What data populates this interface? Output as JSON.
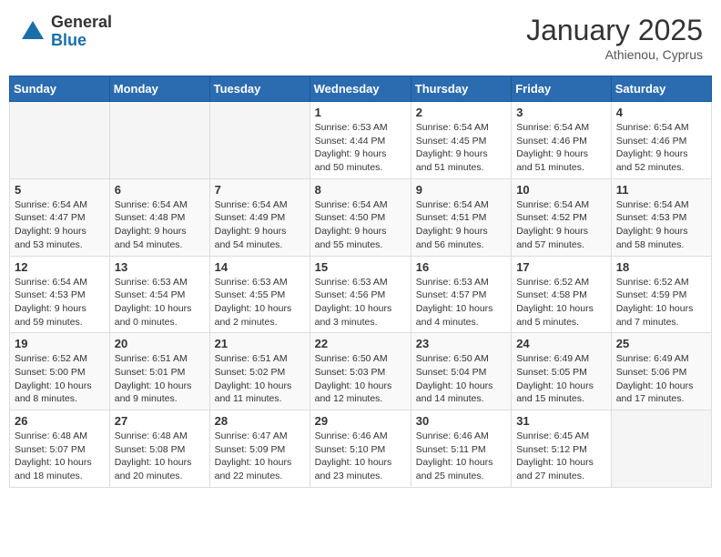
{
  "header": {
    "logo_general": "General",
    "logo_blue": "Blue",
    "month_title": "January 2025",
    "location": "Athienou, Cyprus"
  },
  "days_of_week": [
    "Sunday",
    "Monday",
    "Tuesday",
    "Wednesday",
    "Thursday",
    "Friday",
    "Saturday"
  ],
  "weeks": [
    [
      {
        "day": "",
        "info": ""
      },
      {
        "day": "",
        "info": ""
      },
      {
        "day": "",
        "info": ""
      },
      {
        "day": "1",
        "info": "Sunrise: 6:53 AM\nSunset: 4:44 PM\nDaylight: 9 hours\nand 50 minutes."
      },
      {
        "day": "2",
        "info": "Sunrise: 6:54 AM\nSunset: 4:45 PM\nDaylight: 9 hours\nand 51 minutes."
      },
      {
        "day": "3",
        "info": "Sunrise: 6:54 AM\nSunset: 4:46 PM\nDaylight: 9 hours\nand 51 minutes."
      },
      {
        "day": "4",
        "info": "Sunrise: 6:54 AM\nSunset: 4:46 PM\nDaylight: 9 hours\nand 52 minutes."
      }
    ],
    [
      {
        "day": "5",
        "info": "Sunrise: 6:54 AM\nSunset: 4:47 PM\nDaylight: 9 hours\nand 53 minutes."
      },
      {
        "day": "6",
        "info": "Sunrise: 6:54 AM\nSunset: 4:48 PM\nDaylight: 9 hours\nand 54 minutes."
      },
      {
        "day": "7",
        "info": "Sunrise: 6:54 AM\nSunset: 4:49 PM\nDaylight: 9 hours\nand 54 minutes."
      },
      {
        "day": "8",
        "info": "Sunrise: 6:54 AM\nSunset: 4:50 PM\nDaylight: 9 hours\nand 55 minutes."
      },
      {
        "day": "9",
        "info": "Sunrise: 6:54 AM\nSunset: 4:51 PM\nDaylight: 9 hours\nand 56 minutes."
      },
      {
        "day": "10",
        "info": "Sunrise: 6:54 AM\nSunset: 4:52 PM\nDaylight: 9 hours\nand 57 minutes."
      },
      {
        "day": "11",
        "info": "Sunrise: 6:54 AM\nSunset: 4:53 PM\nDaylight: 9 hours\nand 58 minutes."
      }
    ],
    [
      {
        "day": "12",
        "info": "Sunrise: 6:54 AM\nSunset: 4:53 PM\nDaylight: 9 hours\nand 59 minutes."
      },
      {
        "day": "13",
        "info": "Sunrise: 6:53 AM\nSunset: 4:54 PM\nDaylight: 10 hours\nand 0 minutes."
      },
      {
        "day": "14",
        "info": "Sunrise: 6:53 AM\nSunset: 4:55 PM\nDaylight: 10 hours\nand 2 minutes."
      },
      {
        "day": "15",
        "info": "Sunrise: 6:53 AM\nSunset: 4:56 PM\nDaylight: 10 hours\nand 3 minutes."
      },
      {
        "day": "16",
        "info": "Sunrise: 6:53 AM\nSunset: 4:57 PM\nDaylight: 10 hours\nand 4 minutes."
      },
      {
        "day": "17",
        "info": "Sunrise: 6:52 AM\nSunset: 4:58 PM\nDaylight: 10 hours\nand 5 minutes."
      },
      {
        "day": "18",
        "info": "Sunrise: 6:52 AM\nSunset: 4:59 PM\nDaylight: 10 hours\nand 7 minutes."
      }
    ],
    [
      {
        "day": "19",
        "info": "Sunrise: 6:52 AM\nSunset: 5:00 PM\nDaylight: 10 hours\nand 8 minutes."
      },
      {
        "day": "20",
        "info": "Sunrise: 6:51 AM\nSunset: 5:01 PM\nDaylight: 10 hours\nand 9 minutes."
      },
      {
        "day": "21",
        "info": "Sunrise: 6:51 AM\nSunset: 5:02 PM\nDaylight: 10 hours\nand 11 minutes."
      },
      {
        "day": "22",
        "info": "Sunrise: 6:50 AM\nSunset: 5:03 PM\nDaylight: 10 hours\nand 12 minutes."
      },
      {
        "day": "23",
        "info": "Sunrise: 6:50 AM\nSunset: 5:04 PM\nDaylight: 10 hours\nand 14 minutes."
      },
      {
        "day": "24",
        "info": "Sunrise: 6:49 AM\nSunset: 5:05 PM\nDaylight: 10 hours\nand 15 minutes."
      },
      {
        "day": "25",
        "info": "Sunrise: 6:49 AM\nSunset: 5:06 PM\nDaylight: 10 hours\nand 17 minutes."
      }
    ],
    [
      {
        "day": "26",
        "info": "Sunrise: 6:48 AM\nSunset: 5:07 PM\nDaylight: 10 hours\nand 18 minutes."
      },
      {
        "day": "27",
        "info": "Sunrise: 6:48 AM\nSunset: 5:08 PM\nDaylight: 10 hours\nand 20 minutes."
      },
      {
        "day": "28",
        "info": "Sunrise: 6:47 AM\nSunset: 5:09 PM\nDaylight: 10 hours\nand 22 minutes."
      },
      {
        "day": "29",
        "info": "Sunrise: 6:46 AM\nSunset: 5:10 PM\nDaylight: 10 hours\nand 23 minutes."
      },
      {
        "day": "30",
        "info": "Sunrise: 6:46 AM\nSunset: 5:11 PM\nDaylight: 10 hours\nand 25 minutes."
      },
      {
        "day": "31",
        "info": "Sunrise: 6:45 AM\nSunset: 5:12 PM\nDaylight: 10 hours\nand 27 minutes."
      },
      {
        "day": "",
        "info": ""
      }
    ]
  ]
}
